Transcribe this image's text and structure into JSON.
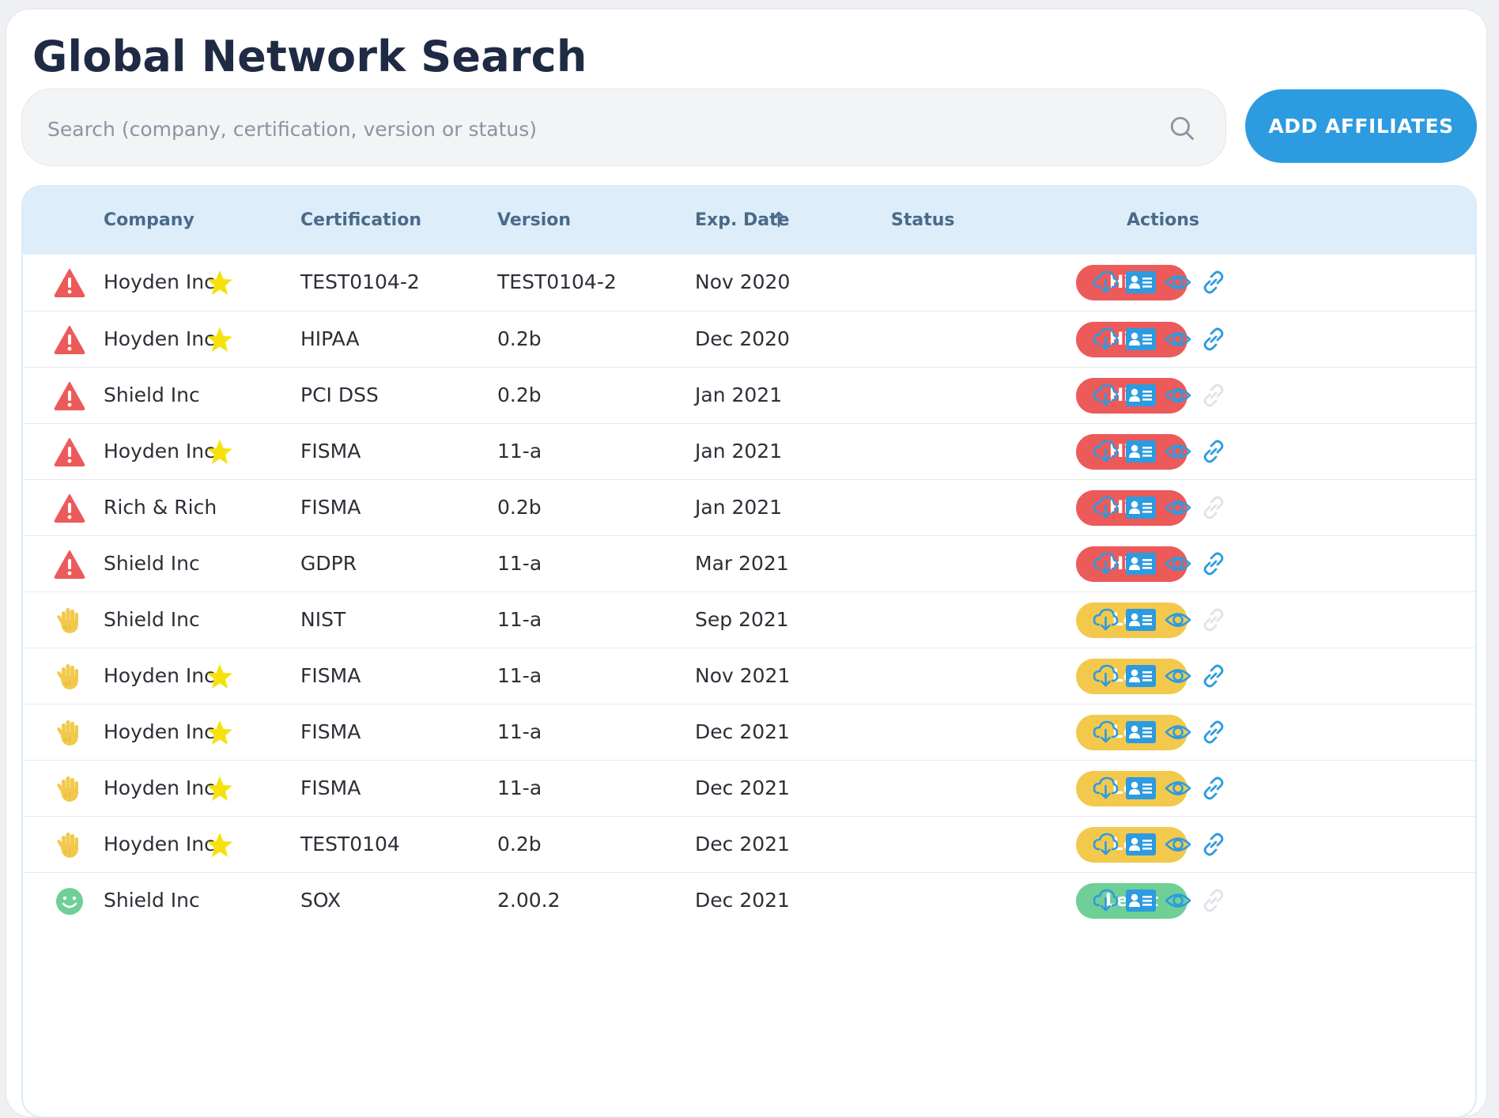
{
  "page": {
    "title": "Global Network Search"
  },
  "search": {
    "placeholder": "Search (company, certification, version or status)",
    "value": ""
  },
  "toolbar": {
    "add_label": "ADD AFFILIATES"
  },
  "table": {
    "columns": {
      "company": "Company",
      "certification": "Certification",
      "version": "Version",
      "exp_date": "Exp. Date",
      "status": "Status",
      "actions": "Actions"
    },
    "sort": {
      "column": "exp_date",
      "direction": "ascending",
      "icon": "arrow-up-icon"
    },
    "rows": [
      {
        "risk": "high",
        "company": "Hoyden Inc",
        "starred": true,
        "certification": "TEST0104-2",
        "version": "TEST0104-2",
        "exp_date": "Nov 2020",
        "status": "High",
        "link_enabled": true
      },
      {
        "risk": "high",
        "company": "Hoyden Inc",
        "starred": true,
        "certification": "HIPAA",
        "version": "0.2b",
        "exp_date": "Dec 2020",
        "status": "High",
        "link_enabled": true
      },
      {
        "risk": "high",
        "company": "Shield Inc",
        "starred": false,
        "certification": "PCI DSS",
        "version": "0.2b",
        "exp_date": "Jan 2021",
        "status": "High",
        "link_enabled": false
      },
      {
        "risk": "high",
        "company": "Hoyden Inc",
        "starred": true,
        "certification": "FISMA",
        "version": "11-a",
        "exp_date": "Jan 2021",
        "status": "High",
        "link_enabled": true
      },
      {
        "risk": "high",
        "company": "Rich & Rich",
        "starred": false,
        "certification": "FISMA",
        "version": "0.2b",
        "exp_date": "Jan 2021",
        "status": "High",
        "link_enabled": false
      },
      {
        "risk": "high",
        "company": "Shield Inc",
        "starred": false,
        "certification": "GDPR",
        "version": "11-a",
        "exp_date": "Mar 2021",
        "status": "High",
        "link_enabled": true
      },
      {
        "risk": "low",
        "company": "Shield Inc",
        "starred": false,
        "certification": "NIST",
        "version": "11-a",
        "exp_date": "Sep 2021",
        "status": "Low",
        "link_enabled": false
      },
      {
        "risk": "low",
        "company": "Hoyden Inc",
        "starred": true,
        "certification": "FISMA",
        "version": "11-a",
        "exp_date": "Nov 2021",
        "status": "Low",
        "link_enabled": true
      },
      {
        "risk": "low",
        "company": "Hoyden Inc",
        "starred": true,
        "certification": "FISMA",
        "version": "11-a",
        "exp_date": "Dec 2021",
        "status": "Low",
        "link_enabled": true
      },
      {
        "risk": "low",
        "company": "Hoyden Inc",
        "starred": true,
        "certification": "FISMA",
        "version": "11-a",
        "exp_date": "Dec 2021",
        "status": "Low",
        "link_enabled": true
      },
      {
        "risk": "low",
        "company": "Hoyden Inc",
        "starred": true,
        "certification": "TEST0104",
        "version": "0.2b",
        "exp_date": "Dec 2021",
        "status": "Low",
        "link_enabled": true
      },
      {
        "risk": "least",
        "company": "Shield Inc",
        "starred": false,
        "certification": "SOX",
        "version": "2.00.2",
        "exp_date": "Dec 2021",
        "status": "Least",
        "link_enabled": false
      }
    ]
  },
  "icons": {
    "risk_high": "warning-triangle-icon",
    "risk_low": "hand-icon",
    "risk_least": "smile-icon",
    "star": "star-icon",
    "actions": [
      "cloud-download-icon",
      "contact-card-icon",
      "eye-icon",
      "link-icon"
    ]
  },
  "colors": {
    "accent": "#2c9be0",
    "high": "#ec5a5a",
    "low": "#f2c94c",
    "least": "#6fcf97",
    "star": "#f5e20a",
    "header_bg": "#ddeefa",
    "title": "#1f2a44"
  }
}
